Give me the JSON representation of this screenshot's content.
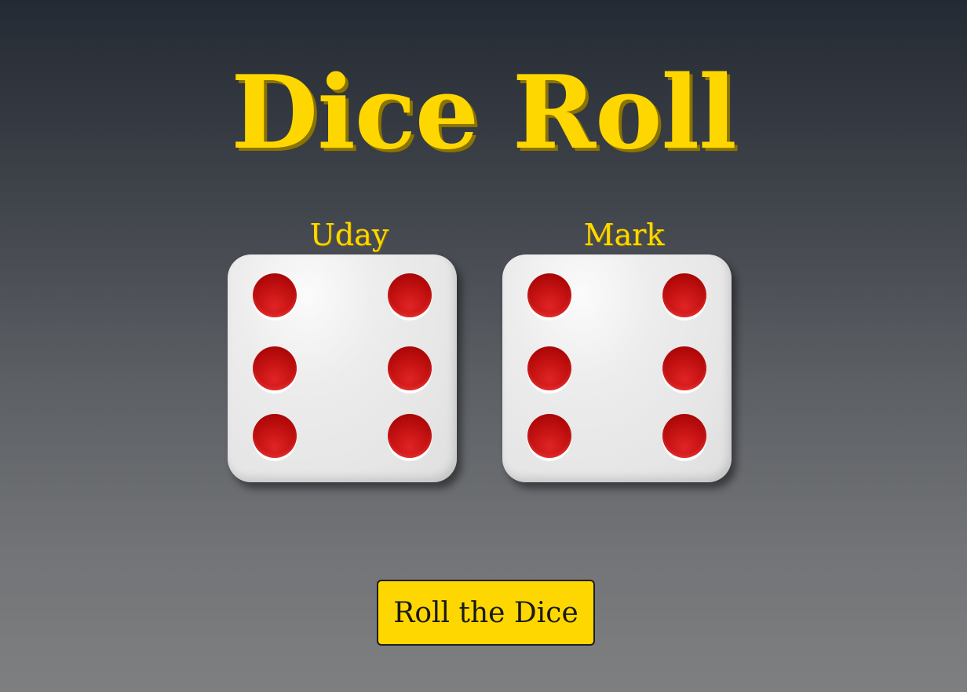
{
  "title": "Dice Roll",
  "players": [
    {
      "name": "Uday",
      "die_value": 6
    },
    {
      "name": "Mark",
      "die_value": 6
    }
  ],
  "button": {
    "label": "Roll the Dice"
  },
  "colors": {
    "accent": "#FFD700",
    "pip": "#CC1111",
    "die": "#E8E8E8"
  }
}
